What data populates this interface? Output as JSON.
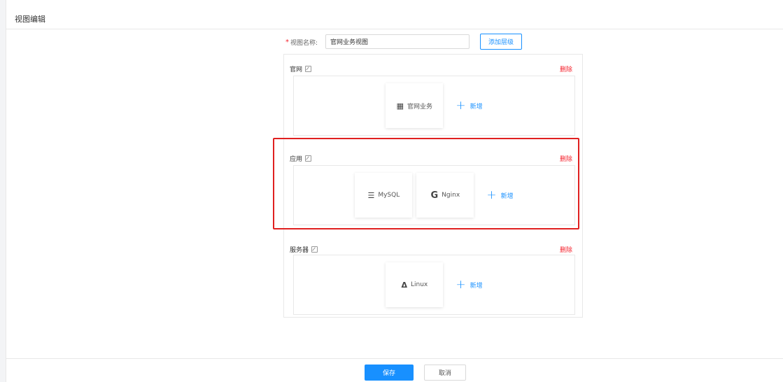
{
  "page": {
    "title": "视图编辑"
  },
  "form": {
    "required_mark": "*",
    "name_label": "视图名称:",
    "name_value": "官网业务视图",
    "add_level_label": "添加层级"
  },
  "layers": [
    {
      "title": "官网",
      "delete_label": "删除",
      "cards": [
        {
          "icon": "building-icon",
          "label": "官网业务"
        }
      ],
      "add_label": "新增"
    },
    {
      "title": "应用",
      "delete_label": "删除",
      "cards": [
        {
          "icon": "database-icon",
          "label": "MySQL"
        },
        {
          "icon": "nginx-icon",
          "label": "Nginx"
        }
      ],
      "add_label": "新增"
    },
    {
      "title": "服务器",
      "delete_label": "删除",
      "cards": [
        {
          "icon": "linux-icon",
          "label": "Linux"
        }
      ],
      "add_label": "新增"
    }
  ],
  "footer": {
    "save_label": "保存",
    "cancel_label": "取消"
  },
  "colors": {
    "primary": "#1890ff",
    "danger": "#f5222d",
    "highlight": "#e02020"
  }
}
